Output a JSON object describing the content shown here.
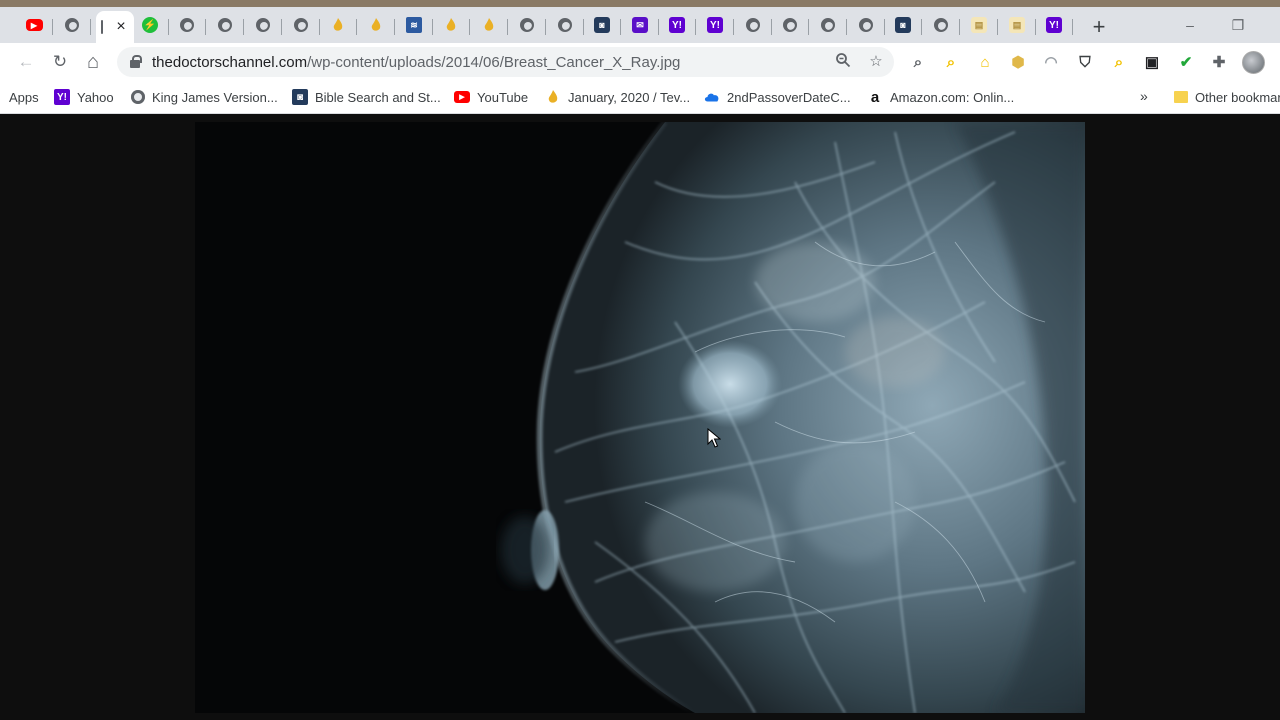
{
  "browser": {
    "tabs": [
      {
        "icon": "youtube-icon",
        "active": false
      },
      {
        "icon": "globe-icon",
        "active": false
      },
      {
        "icon": "blank-page-icon",
        "active": true,
        "close": "×"
      },
      {
        "icon": "green-bolt-icon",
        "active": false
      },
      {
        "icon": "globe-icon",
        "active": false
      },
      {
        "icon": "globe-icon",
        "active": false
      },
      {
        "icon": "globe-icon",
        "active": false
      },
      {
        "icon": "globe-icon",
        "active": false
      },
      {
        "icon": "flame-icon",
        "active": false
      },
      {
        "icon": "flame-icon",
        "active": false
      },
      {
        "icon": "bible-app-icon",
        "active": false
      },
      {
        "icon": "flame-icon",
        "active": false
      },
      {
        "icon": "flame-icon",
        "active": false
      },
      {
        "icon": "globe-icon",
        "active": false
      },
      {
        "icon": "globe-icon",
        "active": false
      },
      {
        "icon": "bible-search-icon",
        "active": false
      },
      {
        "icon": "mail-icon",
        "active": false
      },
      {
        "icon": "yahoo-icon",
        "active": false
      },
      {
        "icon": "yahoo-icon",
        "active": false
      },
      {
        "icon": "globe-icon",
        "active": false
      },
      {
        "icon": "globe-icon",
        "active": false
      },
      {
        "icon": "globe-icon",
        "active": false
      },
      {
        "icon": "globe-icon",
        "active": false
      },
      {
        "icon": "bible-search-icon",
        "active": false
      },
      {
        "icon": "globe-icon",
        "active": false
      },
      {
        "icon": "paper-icon",
        "active": false
      },
      {
        "icon": "paper-icon",
        "active": false
      },
      {
        "icon": "yahoo-icon",
        "active": false
      }
    ],
    "new_tab_label": "+",
    "window_controls": {
      "minimize": "–",
      "restore": "❐"
    },
    "toolbar": {
      "back": "←",
      "reload": "↻",
      "home": "⌂",
      "zoom_icon": "🔍",
      "star_icon": "☆"
    },
    "address": {
      "host": "thedoctorschannel.com",
      "path": "/wp-content/uploads/2014/06/Breast_Cancer_X_Ray.jpg"
    },
    "extensions": [
      {
        "name": "search-extension-icon",
        "glyph": "⌕",
        "color": "#5f6368"
      },
      {
        "name": "yellow-search-extension-icon",
        "glyph": "⌕",
        "color": "#f2c200"
      },
      {
        "name": "home-extension-icon",
        "glyph": "⌂",
        "color": "#f2c200"
      },
      {
        "name": "honey-extension-icon",
        "glyph": "⬢",
        "color": "#e0b84a"
      },
      {
        "name": "headphones-extension-icon",
        "glyph": "◠",
        "color": "#9aa0a6"
      },
      {
        "name": "shield-extension-icon",
        "glyph": "⛉",
        "color": "#3c4043"
      },
      {
        "name": "yellow-search-extension-icon-2",
        "glyph": "⌕",
        "color": "#f2c200"
      },
      {
        "name": "dark-box-extension-icon",
        "glyph": "▣",
        "color": "#202124"
      },
      {
        "name": "green-check-extension-icon",
        "glyph": "✔",
        "color": "#22a83a"
      },
      {
        "name": "puzzle-extensions-icon",
        "glyph": "✚",
        "color": "#5f6368"
      }
    ],
    "bookmarks": [
      {
        "label": "Apps",
        "icon": "apps-icon"
      },
      {
        "label": "Yahoo",
        "icon": "yahoo-icon"
      },
      {
        "label": "King James Version...",
        "icon": "globe-icon"
      },
      {
        "label": "Bible Search and St...",
        "icon": "bible-search-icon"
      },
      {
        "label": "YouTube",
        "icon": "youtube-icon"
      },
      {
        "label": "January, 2020 / Tev...",
        "icon": "flame-icon"
      },
      {
        "label": "2ndPassoverDateC...",
        "icon": "cloud-icon"
      },
      {
        "label": "Amazon.com: Onlin...",
        "icon": "amazon-icon"
      }
    ],
    "overflow_label": "»",
    "other_bookmarks_label": "Other bookmarks"
  },
  "page": {
    "image_subject": "mammogram-xray-image"
  }
}
